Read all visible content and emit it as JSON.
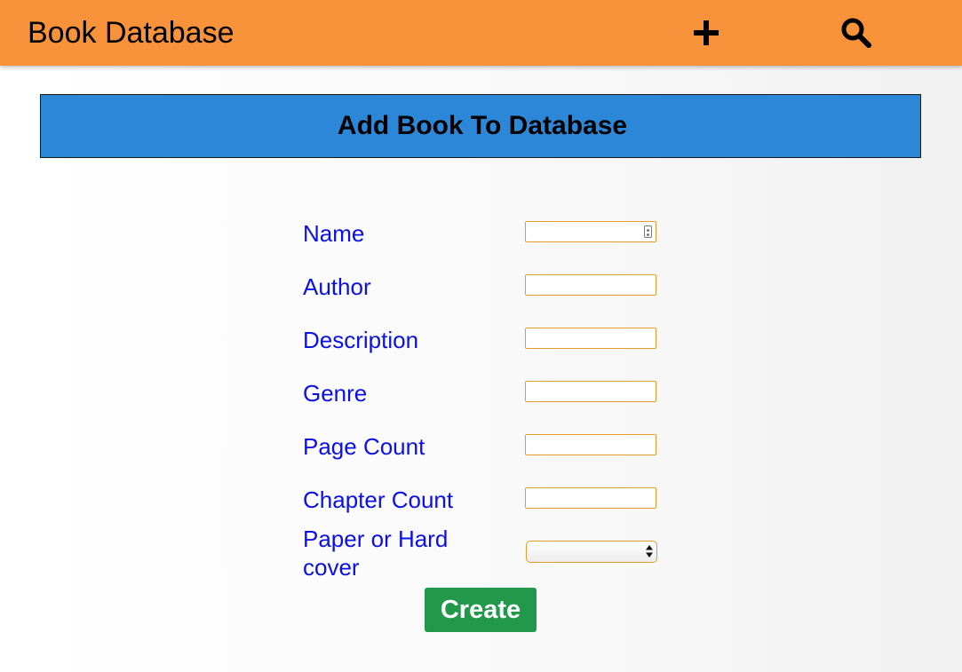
{
  "navbar": {
    "brand": "Book Database",
    "add_icon": "plus-icon",
    "search_icon": "search-icon",
    "color": "#f7923a"
  },
  "header": {
    "title": "Add Book To Database",
    "color": "#2c87d8"
  },
  "form": {
    "fields": [
      {
        "label": "Name",
        "value": ""
      },
      {
        "label": "Author",
        "value": ""
      },
      {
        "label": "Description",
        "value": ""
      },
      {
        "label": "Genre",
        "value": ""
      },
      {
        "label": "Page Count",
        "value": ""
      },
      {
        "label": "Chapter Count",
        "value": ""
      }
    ],
    "cover_label": "Paper or Hard cover",
    "cover_selected": "",
    "submit_label": "Create",
    "label_color": "#0b10e6",
    "button_color": "#21984a"
  }
}
